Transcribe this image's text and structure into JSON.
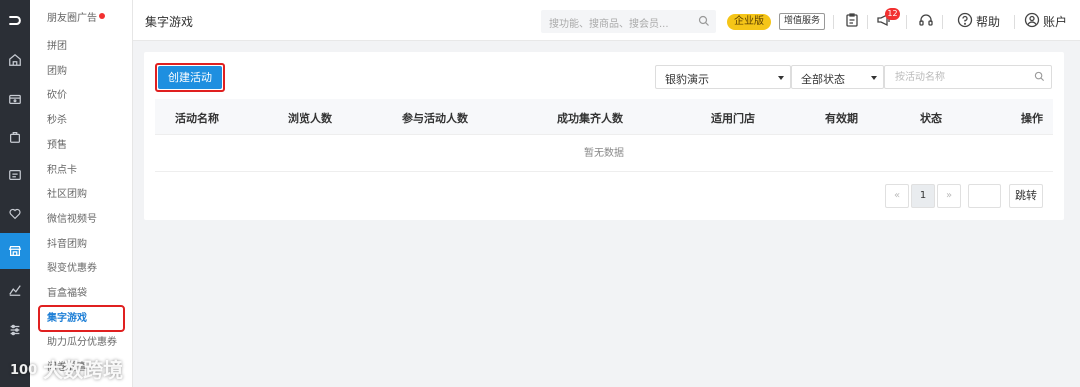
{
  "rail": {
    "logo": "⊃",
    "icons": [
      "home-icon",
      "wallet-icon",
      "bag-icon",
      "card-icon",
      "heart-icon",
      "store-icon",
      "chart-icon",
      "sliders-icon"
    ]
  },
  "submenu": {
    "items": [
      "朋友圈广告",
      "拼团",
      "团购",
      "砍价",
      "秒杀",
      "预售",
      "积点卡",
      "社区团购",
      "微信视频号",
      "抖音团购",
      "裂变优惠券",
      "盲盒福袋",
      "集字游戏",
      "助力瓜分优惠券",
      "问卷调查"
    ],
    "active_index": 12,
    "dot_color": "#f23030"
  },
  "topbar": {
    "title": "集字游戏",
    "search_placeholder": "搜功能、搜商品、搜会员...",
    "enterprise_badge": "企业版",
    "vas_button": "增值服务",
    "notification_count": "12",
    "help": "帮助",
    "account": "账户"
  },
  "toolbar": {
    "create_button": "创建活动",
    "store_select": "银豹演示",
    "status_select": "全部状态",
    "search_placeholder": "按活动名称"
  },
  "table": {
    "columns": [
      "活动名称",
      "浏览人数",
      "参与活动人数",
      "成功集齐人数",
      "适用门店",
      "有效期",
      "状态",
      "操作"
    ],
    "empty_text": "暂无数据"
  },
  "pagination": {
    "prev": "«",
    "current": "1",
    "next": "»",
    "go": "跳转"
  },
  "watermark": {
    "text": "大数跨境",
    "logo": "100"
  },
  "colors": {
    "primary": "#1e8fe0",
    "highlight": "#e02020",
    "rail_bg": "#2b2f36",
    "badge": "#f5c518"
  }
}
